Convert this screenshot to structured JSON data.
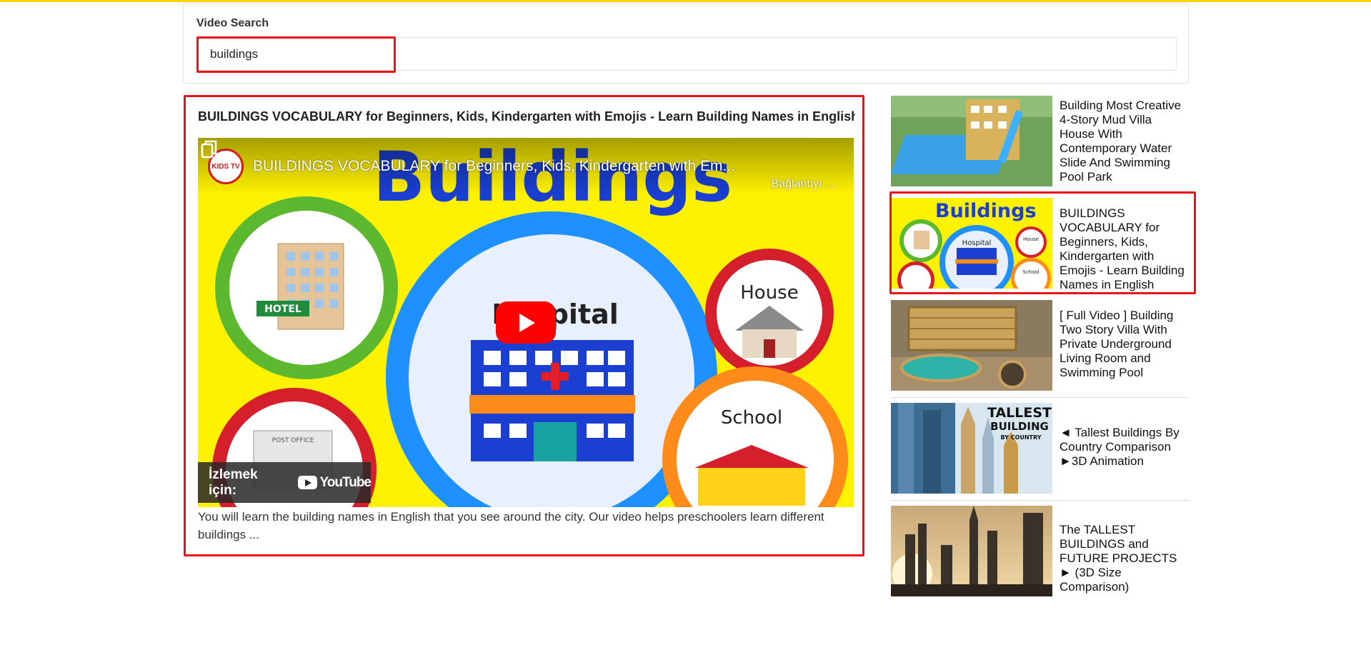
{
  "search": {
    "label": "Video Search",
    "value": "buildings"
  },
  "main_video": {
    "title": "BUILDINGS VOCABULARY for Beginners, Kids, Kindergarten with Emojis - Learn Building Names in English",
    "player_title": "BUILDINGS VOCABULARY for Beginners, Kids, Kindergarten with Em...",
    "channel_avatar": "KIDS TV",
    "copy_link_label": "Bağlantıyı ...",
    "watch_on_label": "İzlemek için:",
    "youtube_label": "YouTube",
    "thumbnail_text": {
      "headline": "Buildings",
      "hotel": "HOTEL",
      "hospital": "Hospital",
      "house": "House",
      "school": "School",
      "post_office": "POST OFFICE"
    },
    "description": "You will learn the building names in English that you see around the city. Our video helps preschoolers learn different buildings ..."
  },
  "related": [
    {
      "title": "Building Most Creative 4-Story Mud Villa House With Contemporary Water Slide And Swimming Pool Park"
    },
    {
      "title": "BUILDINGS VOCABULARY for Beginners, Kids, Kindergarten with Emojis - Learn Building Names in English",
      "thumb_headline": "Buildings",
      "thumb_hospital": "Hospital",
      "thumb_house": "House",
      "thumb_school": "School"
    },
    {
      "title": "[ Full Video ] Building Two Story Villa With Private Underground Living Room and Swimming Pool"
    },
    {
      "title": "◄ Tallest Buildings By Country Comparison ►3D Animation",
      "thumb_line1": "TALLEST",
      "thumb_line2": "BUILDING",
      "thumb_line3": "BY COUNTRY"
    },
    {
      "title": "The TALLEST BUILDINGS and FUTURE PROJECTS ► (3D Size Comparison)"
    }
  ],
  "colors": {
    "accent_top": "#ffd200",
    "highlight": "#e8131a",
    "youtube_red": "#ff0000"
  },
  "icons": [
    "play-icon",
    "copy-link-icon",
    "youtube-logo-icon"
  ]
}
